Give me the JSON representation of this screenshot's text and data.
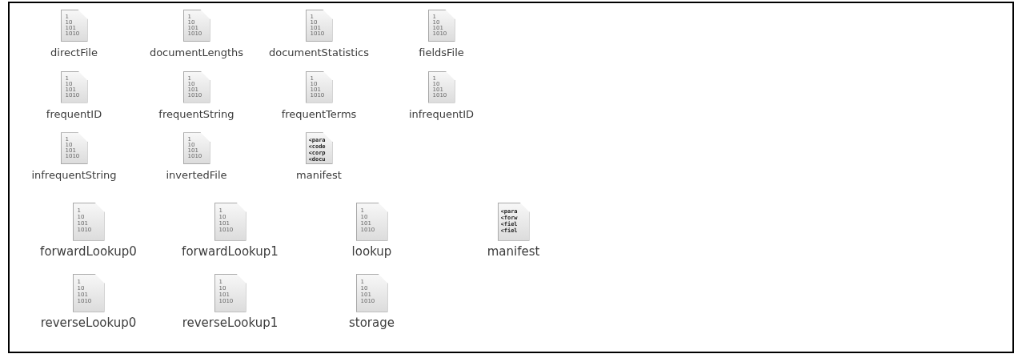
{
  "groups": [
    {
      "files": [
        {
          "name": "directFile",
          "kind": "binary",
          "preview": [
            "1",
            "10",
            "101",
            "1010"
          ]
        },
        {
          "name": "documentLengths",
          "kind": "binary",
          "preview": [
            "1",
            "10",
            "101",
            "1010"
          ]
        },
        {
          "name": "documentStatistics",
          "kind": "binary",
          "preview": [
            "1",
            "10",
            "101",
            "1010"
          ]
        },
        {
          "name": "fieldsFile",
          "kind": "binary",
          "preview": [
            "1",
            "10",
            "101",
            "1010"
          ]
        },
        {
          "name": "frequentID",
          "kind": "binary",
          "preview": [
            "1",
            "10",
            "101",
            "1010"
          ]
        },
        {
          "name": "frequentString",
          "kind": "binary",
          "preview": [
            "1",
            "10",
            "101",
            "1010"
          ]
        },
        {
          "name": "frequentTerms",
          "kind": "binary",
          "preview": [
            "1",
            "10",
            "101",
            "1010"
          ]
        },
        {
          "name": "infrequentID",
          "kind": "binary",
          "preview": [
            "1",
            "10",
            "101",
            "1010"
          ]
        },
        {
          "name": "infrequentString",
          "kind": "binary",
          "preview": [
            "1",
            "10",
            "101",
            "1010"
          ]
        },
        {
          "name": "invertedFile",
          "kind": "binary",
          "preview": [
            "1",
            "10",
            "101",
            "1010"
          ]
        },
        {
          "name": "manifest",
          "kind": "text",
          "preview": [
            "<para",
            "<code",
            "<corp",
            "<docu"
          ]
        }
      ]
    },
    {
      "files": [
        {
          "name": "forwardLookup0",
          "kind": "binary",
          "preview": [
            "1",
            "10",
            "101",
            "1010"
          ]
        },
        {
          "name": "forwardLookup1",
          "kind": "binary",
          "preview": [
            "1",
            "10",
            "101",
            "1010"
          ]
        },
        {
          "name": "lookup",
          "kind": "binary",
          "preview": [
            "1",
            "10",
            "101",
            "1010"
          ]
        },
        {
          "name": "manifest",
          "kind": "text",
          "preview": [
            "<para",
            "<forw",
            "<fiel",
            "<fiel"
          ]
        },
        {
          "name": "reverseLookup0",
          "kind": "binary",
          "preview": [
            "1",
            "10",
            "101",
            "1010"
          ]
        },
        {
          "name": "reverseLookup1",
          "kind": "binary",
          "preview": [
            "1",
            "10",
            "101",
            "1010"
          ]
        },
        {
          "name": "storage",
          "kind": "binary",
          "preview": [
            "1",
            "10",
            "101",
            "1010"
          ]
        }
      ]
    }
  ]
}
